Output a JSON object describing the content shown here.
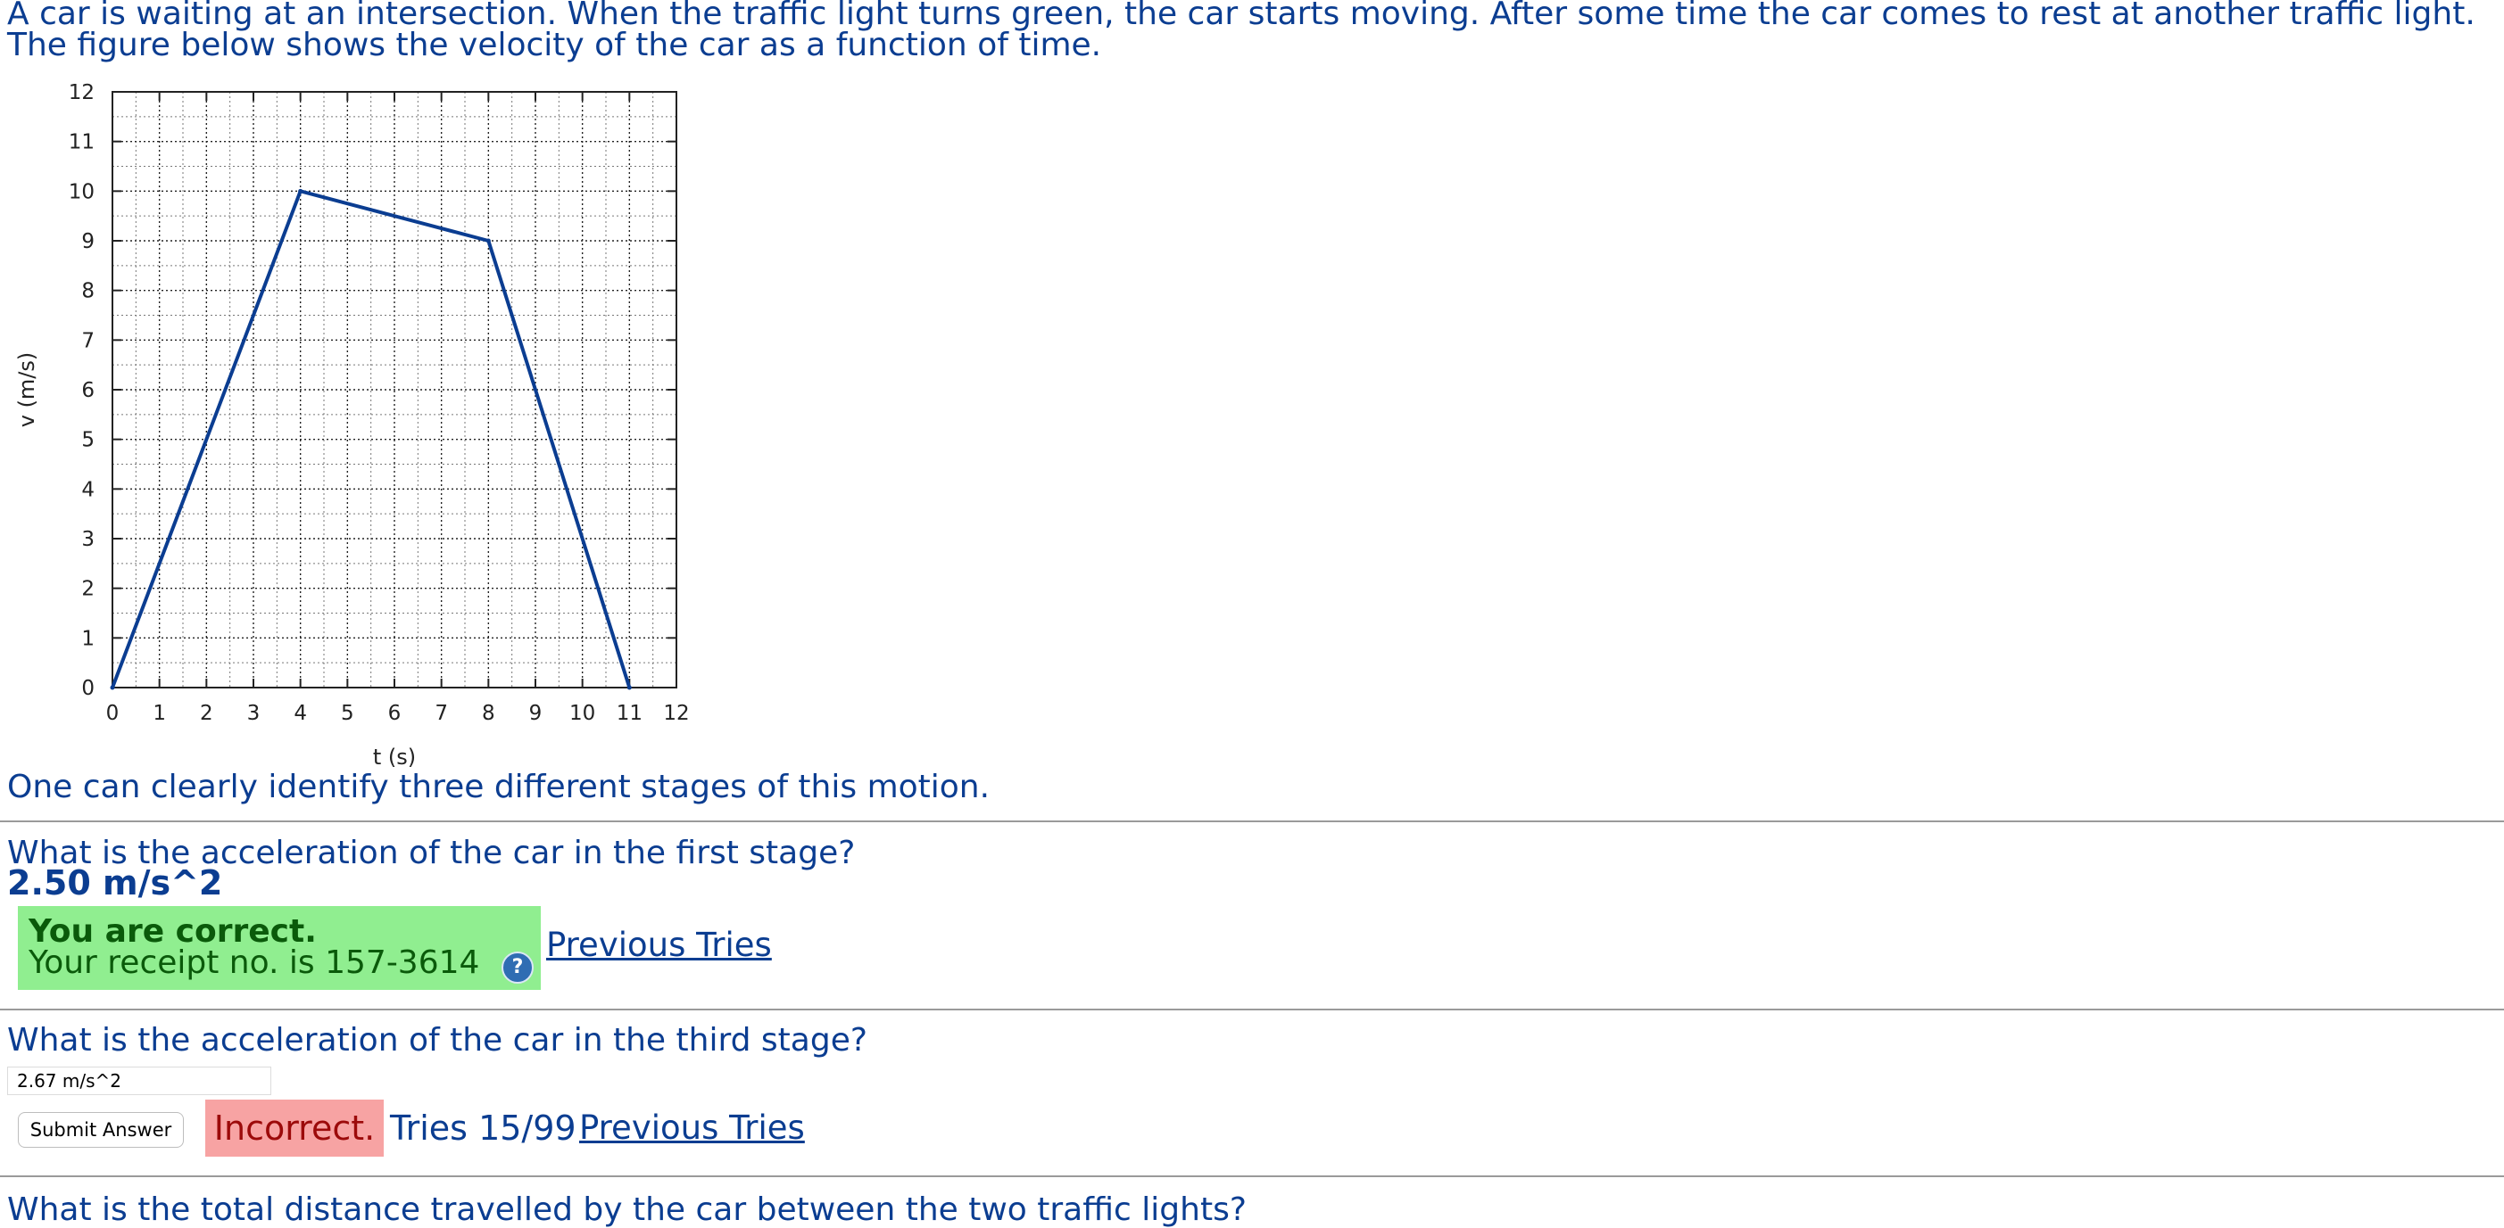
{
  "problem": {
    "intro_line1": "A car is waiting at an intersection. When the traffic light turns green, the car starts moving. After some time the car comes to rest at another traffic light.",
    "intro_line2": "The figure below shows the velocity of the car as a function of time.",
    "stages_text": "One can clearly identify three different stages of this motion."
  },
  "chart_data": {
    "type": "line",
    "xlabel": "t (s)",
    "ylabel": "v (m/s)",
    "xlim": [
      0,
      12
    ],
    "ylim": [
      0,
      12
    ],
    "x_ticks": [
      "0",
      "1",
      "2",
      "3",
      "4",
      "5",
      "6",
      "7",
      "8",
      "9",
      "10",
      "11",
      "12"
    ],
    "y_ticks": [
      "0",
      "1",
      "2",
      "3",
      "4",
      "5",
      "6",
      "7",
      "8",
      "9",
      "10",
      "11",
      "12"
    ],
    "grid": true,
    "series": [
      {
        "x": [
          0,
          4,
          8,
          11
        ],
        "y": [
          0,
          10,
          9,
          0
        ]
      }
    ],
    "line_color": "#0b3d91"
  },
  "question1": {
    "text": "What is the acceleration of the car in the first stage?",
    "answer": "2.50 m/s^2",
    "feedback_title": "You are correct.",
    "receipt": "Your receipt no. is 157-3614",
    "help_icon": "?",
    "previous_tries": "Previous Tries"
  },
  "question2": {
    "text": "What is the acceleration of the car in the third stage?",
    "input_value": "2.67 m/s^2",
    "submit_label": "Submit Answer",
    "status": "Incorrect.",
    "tries": "Tries 15/99",
    "previous_tries": "Previous Tries"
  },
  "question3": {
    "text": "What is the total distance travelled by the car between the two traffic lights?"
  }
}
